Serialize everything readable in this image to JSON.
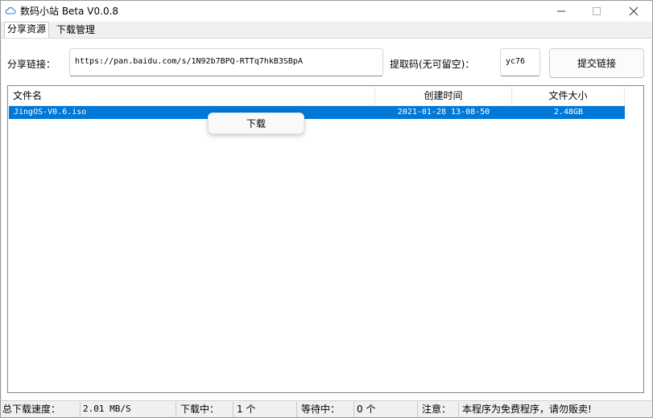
{
  "window": {
    "title": "数码小站 Beta V0.0.8",
    "min_icon": "minimize-icon",
    "max_icon": "maximize-icon",
    "close_icon": "close-icon"
  },
  "tabs": [
    {
      "label": "分享资源"
    },
    {
      "label": "下载管理"
    }
  ],
  "share": {
    "link_label": "分享链接：",
    "link_value": "https://pan.baidu.com/s/1N92b7BPQ-RTTq7hkB3SBpA",
    "code_label": "提取码(无可留空)：",
    "code_value": "yc76",
    "submit_label": "提交链接"
  },
  "list": {
    "columns": [
      "文件名",
      "创建时间",
      "文件大小"
    ],
    "rows": [
      {
        "name": "JingOS-V0.6.iso",
        "created": "2021-01-28 13-08-50",
        "size": "2.48GB"
      }
    ]
  },
  "context_menu": {
    "download_label": "下载"
  },
  "status": {
    "speed_label": "总下载速度：",
    "speed_value": "2.01 MB/S",
    "downloading_label": "下载中：",
    "downloading_value": "1 个",
    "waiting_label": "等待中：",
    "waiting_value": "0 个",
    "note_label": "注意：",
    "note_value": "本程序为免费程序，请勿贩卖!"
  },
  "colors": {
    "selection": "#0078d7",
    "window_bg": "#f0f0f0"
  }
}
